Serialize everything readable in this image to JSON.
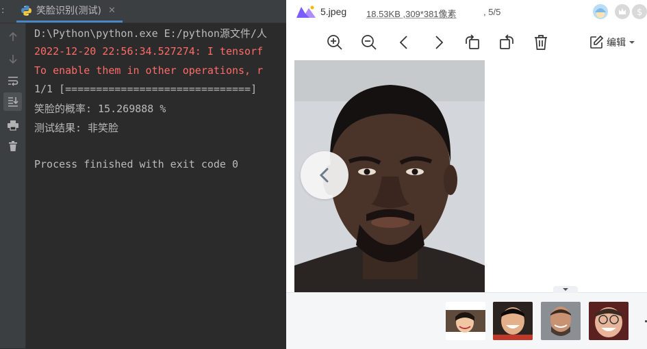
{
  "ide": {
    "run_tab_label": "笑脸识别(测试)",
    "console_lines": [
      {
        "text": "D:\\Python\\python.exe E:/python源文件/人",
        "kind": "normal"
      },
      {
        "text": "2022-12-20 22:56:34.527274: I tensorf",
        "kind": "error"
      },
      {
        "text": "To enable them in other operations, r",
        "kind": "error"
      },
      {
        "text": "1/1 [==============================]",
        "kind": "normal"
      },
      {
        "text": "笑脸的概率: 15.269888 %",
        "kind": "normal"
      },
      {
        "text": "测试结果: 非笑脸",
        "kind": "normal"
      },
      {
        "text": "",
        "kind": "normal"
      },
      {
        "text": "Process finished with exit code 0",
        "kind": "normal"
      }
    ],
    "gutter_icons": [
      "up-arrow-icon",
      "down-arrow-icon",
      "soft-wrap-icon",
      "scroll-to-end-icon",
      "print-icon",
      "trash-icon"
    ]
  },
  "viewer": {
    "filename": "5.jpeg",
    "meta": "18.53KB ,309*381像素",
    "counter": ", 5/5",
    "edit_label": "编辑",
    "toolbar_icons": [
      "zoom-in-icon",
      "zoom-out-icon",
      "prev-icon",
      "next-icon",
      "rotate-left-icon",
      "rotate-right-icon",
      "delete-icon"
    ],
    "thumbnails": [
      "thumbnail-1",
      "thumbnail-2",
      "thumbnail-3",
      "thumbnail-4"
    ],
    "colors": {
      "accent": "#4a88c7",
      "error_text": "#ff6b68",
      "console_text": "#bbbbbb"
    }
  }
}
